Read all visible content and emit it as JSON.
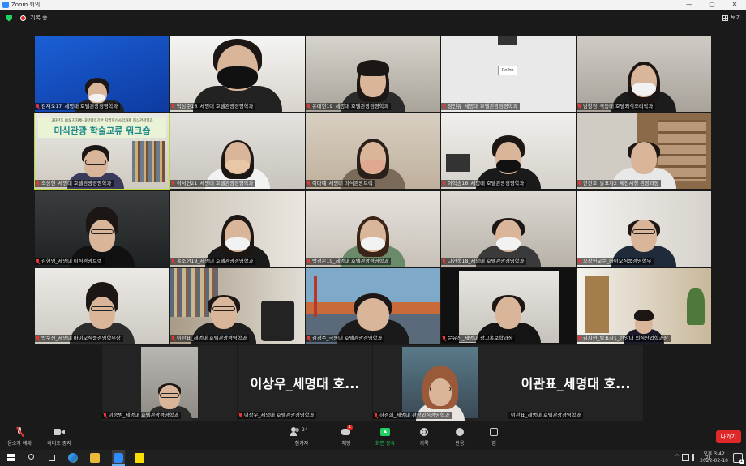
{
  "window": {
    "title": "Zoom 회의",
    "controls": [
      "—",
      "▢",
      "✕"
    ]
  },
  "meeting": {
    "recording_label": "기록 중",
    "view_label": "보기"
  },
  "tiles": [
    {
      "name": "김재오17_세명대 호텔관광경영학과"
    },
    {
      "name": "박상준16_세명대 호텔관광경영학과"
    },
    {
      "name": "유대현19_세명대 호텔관광경영학과"
    },
    {
      "name": "정인유_세명대 호텔관광경영학과"
    },
    {
      "name": "남청경_극동대 호텔외식조리학과"
    },
    {
      "name": "조상현_세명대 호텔관광경영학과",
      "banner_small": "3차년도 RIS 지자체-대학협력기반 지역혁신사업과제 미식관광학과",
      "banner_big": "미식관광 학술교류 워크숍"
    },
    {
      "name": "이서연21_세명대 호텔관광경영학과"
    },
    {
      "name": "이다예_세명대 미식관광트랙"
    },
    {
      "name": "이학승16_세명대 호텔관광경영학과"
    },
    {
      "name": "한진호_발표자2_제천시청 관광과장"
    },
    {
      "name": "김현영_세명대 미식관광트랙"
    },
    {
      "name": "홍소현19_세명대 호텔관광경영학과"
    },
    {
      "name": "박경은19_세명대 호텔관광경영학과"
    },
    {
      "name": "나현욱18_세명대 호텔관광경영학과"
    },
    {
      "name": "오창헌교수_바이오식품경영학부"
    },
    {
      "name": "박수진_세명대 바이오식품경영학부장"
    },
    {
      "name": "이관표_세명대 호텔관광경영학과"
    },
    {
      "name": "김경수_극동대 호텔관광경영학과"
    },
    {
      "name": "문유진_세명대 광고홍보학과장"
    },
    {
      "name": "김지현_발표자1_한양대 외식산업학과장"
    },
    {
      "name": "이승범_세명대 호텔관광경영학과"
    },
    {
      "name": "이상우_세명대 호텔관광경영학과",
      "big": "이상우_세명대 호..."
    },
    {
      "name": "하경희_세명대 관광외식경영학과"
    },
    {
      "name": "이관표_세명대 호텔관광경영학과",
      "big": "이관표_세명대 호..."
    }
  ],
  "toolbar": {
    "mute_label": "음소거 해제",
    "video_label": "비디오 중지",
    "participants_label": "참가자",
    "participants_count": "24",
    "chat_label": "채팅",
    "chat_badge": "1",
    "share_label": "화면 공유",
    "record_label": "기록",
    "reaction_label": "반응",
    "apps_label": "앱",
    "leave_label": "나가기"
  },
  "taskbar": {
    "ime": "가",
    "time": "오후 3:42",
    "date": "2022-02-10",
    "notification_count": "1"
  },
  "colors": {
    "share_green": "#23d160",
    "leave_red": "#e02828",
    "active_speaker": "#b9d93a",
    "zoom_blue": "#2d8cff"
  }
}
